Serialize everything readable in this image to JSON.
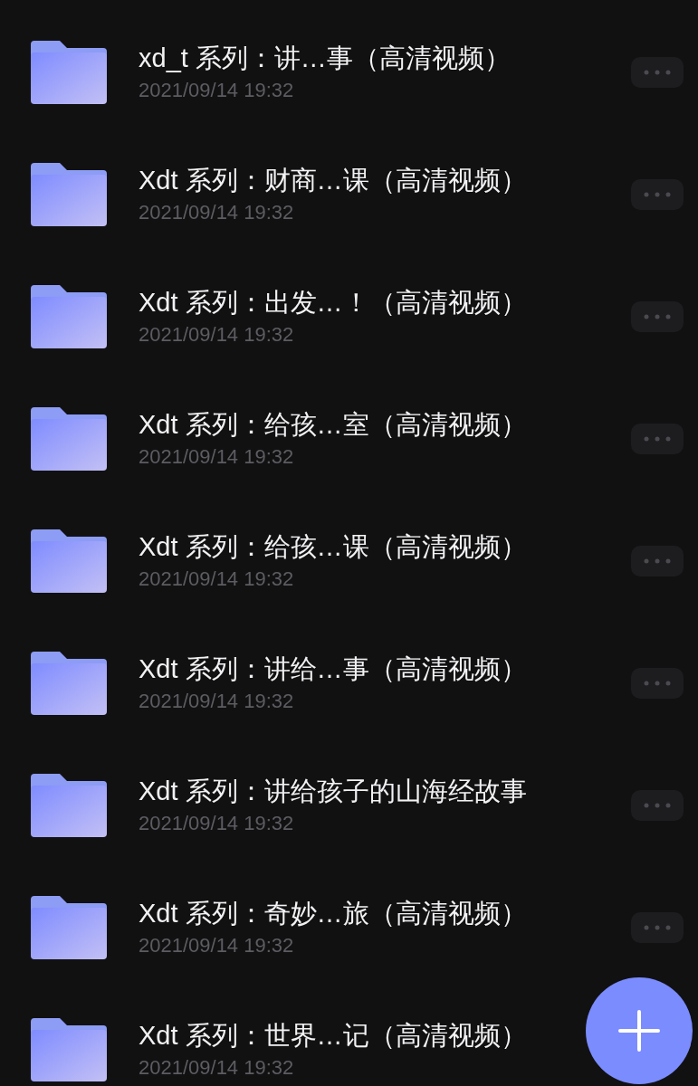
{
  "files": [
    {
      "name": "xd_t 系列：讲…事（高清视频）",
      "date": "2021/09/14 19:32",
      "menu": true
    },
    {
      "name": "Xdt 系列：财商…课（高清视频）",
      "date": "2021/09/14 19:32",
      "menu": true
    },
    {
      "name": "Xdt 系列：出发…！（高清视频）",
      "date": "2021/09/14 19:32",
      "menu": true
    },
    {
      "name": "Xdt 系列：给孩…室（高清视频）",
      "date": "2021/09/14 19:32",
      "menu": true
    },
    {
      "name": "Xdt 系列：给孩…课（高清视频）",
      "date": "2021/09/14 19:32",
      "menu": true
    },
    {
      "name": "Xdt 系列：讲给…事（高清视频）",
      "date": "2021/09/14 19:32",
      "menu": true
    },
    {
      "name": "Xdt 系列：讲给孩子的山海经故事",
      "date": "2021/09/14 19:32",
      "menu": true
    },
    {
      "name": "Xdt 系列：奇妙…旅（高清视频）",
      "date": "2021/09/14 19:32",
      "menu": true
    },
    {
      "name": "Xdt 系列：世界…记（高清视频）",
      "date": "2021/09/14 19:32",
      "menu": false
    }
  ],
  "add_button": {
    "visible": true
  }
}
